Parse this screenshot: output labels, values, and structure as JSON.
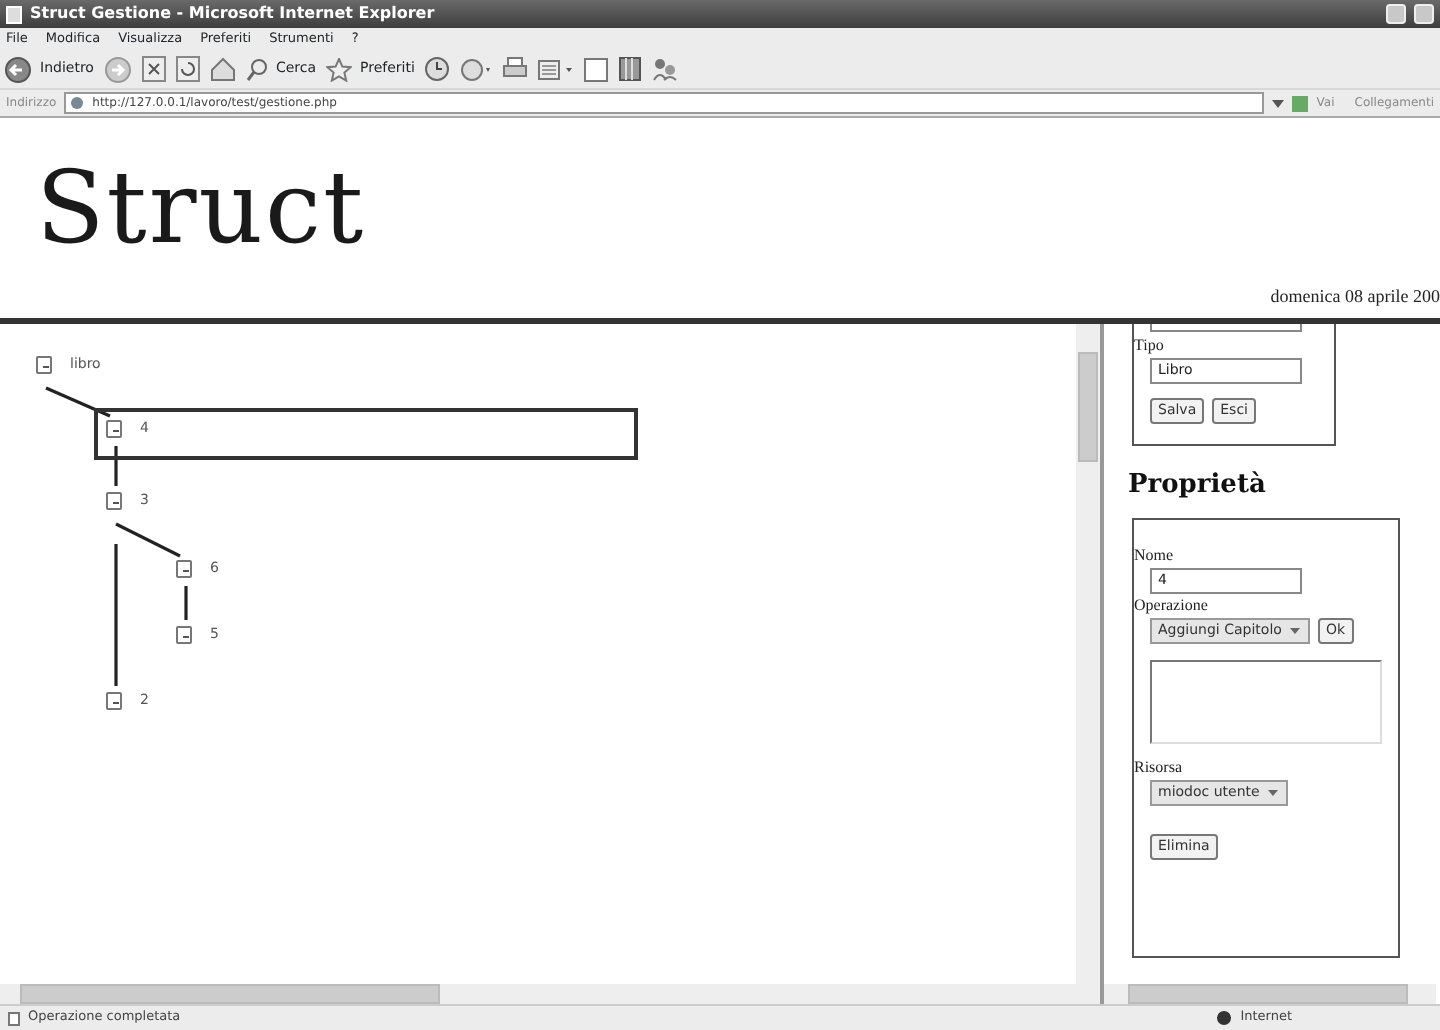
{
  "window": {
    "title": "Struct Gestione - Microsoft Internet Explorer"
  },
  "menu": [
    "File",
    "Modifica",
    "Visualizza",
    "Preferiti",
    "Strumenti",
    "?"
  ],
  "toolbar": {
    "back": "Indietro",
    "search": "Cerca",
    "favorites": "Preferiti"
  },
  "address_bar": {
    "label": "Indirizzo",
    "url": "http://127.0.0.1/lavoro/test/gestione.php",
    "go": "Vai",
    "links": "Collegamenti"
  },
  "header": {
    "logo": "Struct",
    "date": "domenica 08 aprile 200"
  },
  "tree": {
    "label": "libro",
    "expanded": true,
    "selected": false,
    "children": [
      {
        "label": "4",
        "expanded": true,
        "selected": true
      },
      {
        "label": "3",
        "expanded": true,
        "selected": false,
        "children": [
          {
            "label": "6",
            "expanded": true,
            "selected": false
          },
          {
            "label": "5",
            "expanded": true,
            "selected": false
          }
        ]
      },
      {
        "label": "2",
        "expanded": true,
        "selected": false
      }
    ]
  },
  "form_top": {
    "type_label": "Tipo",
    "type_value": "Libro",
    "buttons": [
      "Salva",
      "Esci"
    ]
  },
  "properties": {
    "title": "Proprietà",
    "name_label": "Nome",
    "name_value": "4",
    "operation_label": "Operazione",
    "operation_value": "Aggiungi Capitolo",
    "ok": "Ok",
    "resource_label": "Risorsa",
    "resource_value": "miodoc utente",
    "delete": "Elimina"
  },
  "status_bar": {
    "message": "Operazione completata",
    "zone": "Internet"
  }
}
